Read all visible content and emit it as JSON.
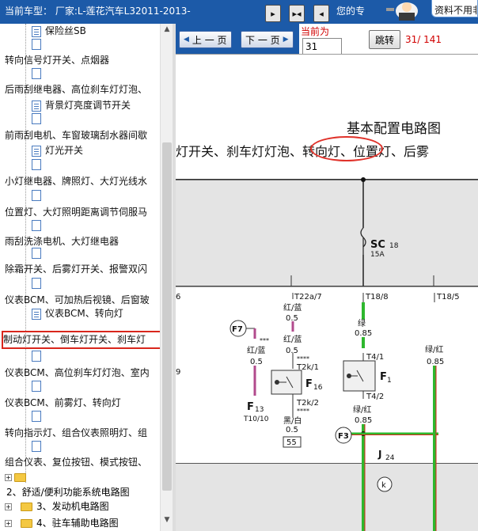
{
  "header": {
    "car_title": "当前车型：  厂家:L-莲花汽车L32011-2013-",
    "nav_icons": [
      "first-page-icon",
      "split-view-icon",
      "last-page-icon"
    ],
    "your_pro": "您的专",
    "notice": "资料不用非"
  },
  "tree": {
    "items": [
      {
        "label": "保险丝SB",
        "kind": "doc"
      },
      {
        "label": "转向信号灯开关、点烟器",
        "kind": "text"
      },
      {
        "label": "后雨刮继电器、高位刹车灯灯泡、",
        "kind": "text"
      },
      {
        "label": "背景灯亮度调节开关",
        "kind": "doc"
      },
      {
        "label": "前雨刮电机、车窗玻璃刮水器间歇",
        "kind": "text"
      },
      {
        "label": "灯光开关",
        "kind": "doc"
      },
      {
        "label": "小灯继电器、牌照灯、大灯光线水",
        "kind": "text"
      },
      {
        "label": "位置灯、大灯照明距离调节伺服马",
        "kind": "text"
      },
      {
        "label": "雨刮洗涤电机、大灯继电器",
        "kind": "text"
      },
      {
        "label": "除霜开关、后雾灯开关、报警双闪",
        "kind": "text"
      },
      {
        "label": "仪表BCM、可加热后视镜、后窗玻",
        "kind": "text"
      },
      {
        "label": "仪表BCM、转向灯",
        "kind": "doc"
      },
      {
        "label": "制动灯开关、倒车灯开关、刹车灯",
        "kind": "text",
        "selected": true
      },
      {
        "label": "仪表BCM、高位刹车灯灯泡、室内",
        "kind": "text"
      },
      {
        "label": "仪表BCM、前雾灯、转向灯",
        "kind": "text"
      },
      {
        "label": "转向指示灯、组合仪表照明灯、组",
        "kind": "text"
      },
      {
        "label": "组合仪表、复位按钮、模式按钮、",
        "kind": "text"
      }
    ],
    "folders": [
      {
        "label": "",
        "expander": "+"
      },
      {
        "label": "2、舒适/便利功能系统电路图",
        "expander": ""
      },
      {
        "label": "3、发动机电路图",
        "expander": "+"
      },
      {
        "label": "4、驻车辅助电路图",
        "expander": "+"
      }
    ]
  },
  "toolbar": {
    "prev_label": "上 一 页",
    "next_label": "下 一 页",
    "current_label": "当前为",
    "page_value": "31",
    "jump_label": "跳转",
    "page_count": "31/ 141"
  },
  "diagram": {
    "title": "基本配置电路图",
    "subtitle": "灯开关、刹车灯灯泡、转向灯、位置灯、后雾",
    "labels": {
      "sc": "SC",
      "sc_num": "18",
      "sc_amp": "15A",
      "t22a7": "T22a/7",
      "t18_8": "T18/8",
      "t18_5": "T18/5",
      "red_blue": "红/蓝",
      "v05": "0.5",
      "green": "绿",
      "v085": "0.85",
      "green_red": "绿/红",
      "f7": "F7",
      "f3": "F3",
      "f1": "F",
      "f1_sub": "1",
      "f16": "F",
      "f16_sub": "16",
      "f13": "F",
      "f13_sub": "13",
      "t10_10": "T10/10",
      "t2k1": "T2k/1",
      "t2k2": "T2k/2",
      "t4_1": "T4/1",
      "t4_2": "T4/2",
      "black_white": "黑/白",
      "box55": "55",
      "j24": "J",
      "j24_sub": "24",
      "k": "k",
      "stars3": "***",
      "stars4": "****",
      "six": "6",
      "nine": "9"
    }
  }
}
